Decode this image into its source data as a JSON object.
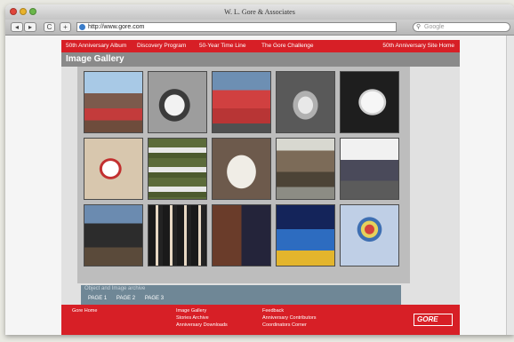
{
  "window": {
    "title": "W. L. Gore & Associates"
  },
  "toolbar": {
    "back": "◂",
    "forward": "▸",
    "reload": "C",
    "add": "+",
    "url": "http://www.gore.com",
    "search_placeholder": "Google"
  },
  "nav": {
    "items": [
      "50th Anniversary Album",
      "Discovery Program",
      "50-Year Time Line",
      "The Gore Challenge"
    ],
    "right": "50th Anniversary Site Home"
  },
  "gallery": {
    "title": "Image Gallery"
  },
  "archive": {
    "title": "Object and Image archive",
    "pages": [
      "PAGE 1",
      "PAGE 2",
      "PAGE 3"
    ]
  },
  "footer": {
    "col1": [
      "Gore Home"
    ],
    "col2": [
      "Image Gallery",
      "Stories Archive",
      "Anniversary Downloads"
    ],
    "col3": [
      "Feedback",
      "Anniversary Contributors",
      "Coordinators Corner"
    ],
    "logo": "GORE"
  },
  "colors": {
    "brand_red": "#d71f26",
    "archive_bar": "#6f8796"
  }
}
